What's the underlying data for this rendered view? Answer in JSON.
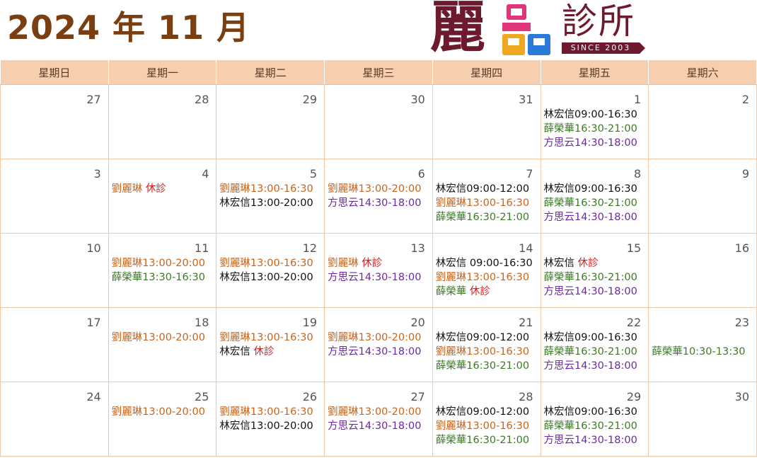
{
  "header": {
    "title": "2024 年 11 月",
    "logo": {
      "main": "麗",
      "sub": "診所",
      "tagline": "SINCE 2003"
    }
  },
  "weekdays": [
    "星期日",
    "星期一",
    "星期二",
    "星期三",
    "星期四",
    "星期五",
    "星期六"
  ],
  "colors": {
    "black": "#111111",
    "orange": "#c8641c",
    "green": "#3c7a26",
    "purple": "#6a2aa0",
    "off": "#d62020",
    "header_bg": "#f8cfae"
  },
  "weeks": [
    [
      {
        "day": "27",
        "events": []
      },
      {
        "day": "28",
        "events": []
      },
      {
        "day": "29",
        "events": []
      },
      {
        "day": "30",
        "events": []
      },
      {
        "day": "31",
        "events": []
      },
      {
        "day": "1",
        "events": [
          {
            "text": "林宏信09:00-16:30",
            "color": "black",
            "off": ""
          },
          {
            "text": "薛榮華16:30-21:00",
            "color": "green",
            "off": ""
          },
          {
            "text": "方思云14:30-18:00",
            "color": "purple",
            "off": ""
          }
        ]
      },
      {
        "day": "2",
        "events": []
      }
    ],
    [
      {
        "day": "3",
        "events": []
      },
      {
        "day": "4",
        "events": [
          {
            "text": "劉麗琳 ",
            "color": "orange",
            "off": "休診"
          }
        ]
      },
      {
        "day": "5",
        "events": [
          {
            "text": "劉麗琳13:00-16:30",
            "color": "orange",
            "off": ""
          },
          {
            "text": "林宏信13:00-20:00",
            "color": "black",
            "off": ""
          }
        ]
      },
      {
        "day": "6",
        "events": [
          {
            "text": "劉麗琳13:00-20:00",
            "color": "orange",
            "off": ""
          },
          {
            "text": "方思云14:30-18:00",
            "color": "purple",
            "off": ""
          }
        ]
      },
      {
        "day": "7",
        "events": [
          {
            "text": "林宏信09:00-12:00",
            "color": "black",
            "off": ""
          },
          {
            "text": "劉麗琳13:00-16:30",
            "color": "orange",
            "off": ""
          },
          {
            "text": "薛榮華16:30-21:00",
            "color": "green",
            "off": ""
          }
        ]
      },
      {
        "day": "8",
        "events": [
          {
            "text": "林宏信09:00-16:30",
            "color": "black",
            "off": ""
          },
          {
            "text": "薛榮華16:30-21:00",
            "color": "green",
            "off": ""
          },
          {
            "text": "方思云14:30-18:00",
            "color": "purple",
            "off": ""
          }
        ]
      },
      {
        "day": "9",
        "events": []
      }
    ],
    [
      {
        "day": "10",
        "events": []
      },
      {
        "day": "11",
        "events": [
          {
            "text": "劉麗琳13:00-20:00",
            "color": "orange",
            "off": ""
          },
          {
            "text": "薛榮華13:30-16:30",
            "color": "green",
            "off": ""
          }
        ]
      },
      {
        "day": "12",
        "events": [
          {
            "text": "劉麗琳13:00-16:30",
            "color": "orange",
            "off": ""
          },
          {
            "text": "林宏信13:00-20:00",
            "color": "black",
            "off": ""
          }
        ]
      },
      {
        "day": "13",
        "events": [
          {
            "text": "劉麗琳 ",
            "color": "orange",
            "off": "休診"
          },
          {
            "text": "方思云14:30-18:00",
            "color": "purple",
            "off": ""
          }
        ]
      },
      {
        "day": "14",
        "events": [
          {
            "text": "林宏信 09:00-16:30",
            "color": "black",
            "off": ""
          },
          {
            "text": "劉麗琳13:00-16:30",
            "color": "orange",
            "off": ""
          },
          {
            "text": "薛榮華 ",
            "color": "green",
            "off": "休診"
          }
        ]
      },
      {
        "day": "15",
        "events": [
          {
            "text": "林宏信 ",
            "color": "black",
            "off": "休診"
          },
          {
            "text": "薛榮華16:30-21:00",
            "color": "green",
            "off": ""
          },
          {
            "text": "方思云14:30-18:00",
            "color": "purple",
            "off": ""
          }
        ]
      },
      {
        "day": "16",
        "events": []
      }
    ],
    [
      {
        "day": "17",
        "events": []
      },
      {
        "day": "18",
        "events": [
          {
            "text": "劉麗琳13:00-20:00",
            "color": "orange",
            "off": ""
          }
        ]
      },
      {
        "day": "19",
        "events": [
          {
            "text": "劉麗琳13:00-16:30",
            "color": "orange",
            "off": ""
          },
          {
            "text": "林宏信 ",
            "color": "black",
            "off": "休診"
          }
        ]
      },
      {
        "day": "20",
        "events": [
          {
            "text": "劉麗琳13:00-20:00",
            "color": "orange",
            "off": ""
          },
          {
            "text": "方思云14:30-18:00",
            "color": "purple",
            "off": ""
          }
        ]
      },
      {
        "day": "21",
        "events": [
          {
            "text": "林宏信09:00-12:00",
            "color": "black",
            "off": ""
          },
          {
            "text": "劉麗琳13:00-16:30",
            "color": "orange",
            "off": ""
          },
          {
            "text": "薛榮華16:30-21:00",
            "color": "green",
            "off": ""
          }
        ]
      },
      {
        "day": "22",
        "events": [
          {
            "text": "林宏信09:00-16:30",
            "color": "black",
            "off": ""
          },
          {
            "text": "薛榮華16:30-21:00",
            "color": "green",
            "off": ""
          },
          {
            "text": "方思云14:30-18:00",
            "color": "purple",
            "off": ""
          }
        ]
      },
      {
        "day": "23",
        "events": [
          {
            "text": "",
            "color": "green",
            "off": ""
          },
          {
            "text": "薛榮華10:30-13:30",
            "color": "green",
            "off": ""
          }
        ]
      }
    ],
    [
      {
        "day": "24",
        "events": []
      },
      {
        "day": "25",
        "events": [
          {
            "text": "劉麗琳13:00-20:00",
            "color": "orange",
            "off": ""
          }
        ]
      },
      {
        "day": "26",
        "events": [
          {
            "text": "劉麗琳13:00-16:30",
            "color": "orange",
            "off": ""
          },
          {
            "text": "林宏信13:00-20:00",
            "color": "black",
            "off": ""
          }
        ]
      },
      {
        "day": "27",
        "events": [
          {
            "text": "劉麗琳13:00-20:00",
            "color": "orange",
            "off": ""
          },
          {
            "text": "方思云14:30-18:00",
            "color": "purple",
            "off": ""
          }
        ]
      },
      {
        "day": "28",
        "events": [
          {
            "text": "林宏信09:00-12:00",
            "color": "black",
            "off": ""
          },
          {
            "text": "劉麗琳13:00-16:30",
            "color": "orange",
            "off": ""
          },
          {
            "text": "薛榮華16:30-21:00",
            "color": "green",
            "off": ""
          }
        ]
      },
      {
        "day": "29",
        "events": [
          {
            "text": "林宏信09:00-16:30",
            "color": "black",
            "off": ""
          },
          {
            "text": "薛榮華16:30-21:00",
            "color": "green",
            "off": ""
          },
          {
            "text": "方思云14:30-18:00",
            "color": "purple",
            "off": ""
          }
        ]
      },
      {
        "day": "30",
        "events": []
      }
    ]
  ]
}
